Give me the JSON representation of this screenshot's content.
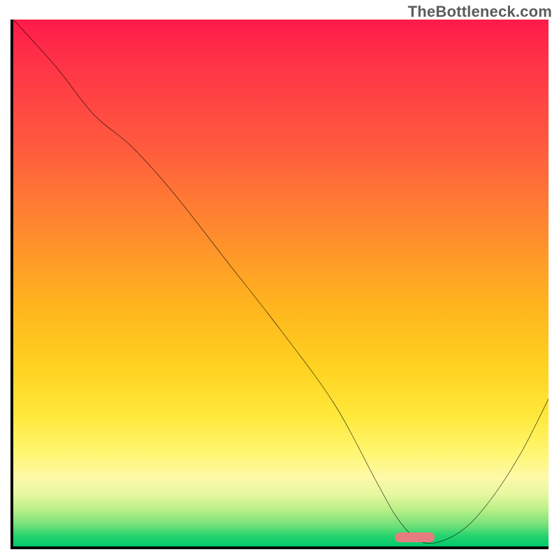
{
  "watermark": "TheBottleneck.com",
  "colors": {
    "salmon_marker": "#e77c80",
    "curve_stroke": "#000000"
  },
  "chart_data": {
    "type": "line",
    "title": "",
    "xlabel": "",
    "ylabel": "",
    "xlim": [
      0,
      100
    ],
    "ylim": [
      0,
      100
    ],
    "grid": false,
    "legend": false,
    "note": "Single black curve over a vertical red-to-green gradient background. Curve descends from top-left, flattens near the bottom around x≈70–80, then rises toward the right edge.",
    "series": [
      {
        "name": "curve",
        "x": [
          0,
          8,
          15,
          22,
          30,
          40,
          50,
          60,
          68,
          72,
          76,
          80,
          85,
          90,
          95,
          100
        ],
        "y": [
          100,
          91,
          82,
          76,
          67,
          54,
          41,
          27,
          12,
          5,
          1,
          1,
          4,
          10,
          18,
          28
        ]
      }
    ],
    "markers": [
      {
        "name": "salmon-bar",
        "x_center": 75,
        "y": 0.8,
        "width_pct": 7.5
      }
    ]
  }
}
